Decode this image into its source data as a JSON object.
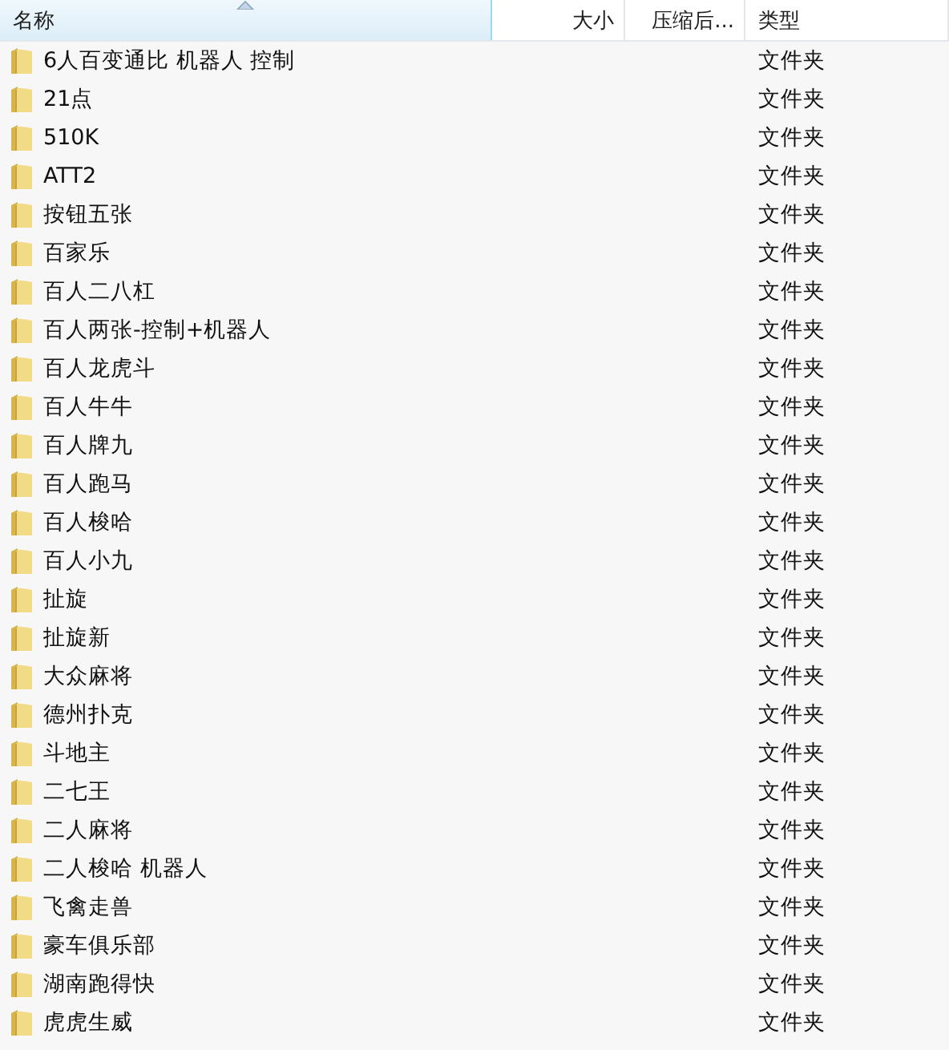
{
  "columns": [
    {
      "label": "名称",
      "sorted": true
    },
    {
      "label": "大小",
      "sorted": false
    },
    {
      "label": "压缩后...",
      "sorted": false
    },
    {
      "label": "类型",
      "sorted": false
    }
  ],
  "rows": [
    {
      "name": "6人百变通比 机器人 控制",
      "type": "文件夹"
    },
    {
      "name": "21点",
      "type": "文件夹"
    },
    {
      "name": "510K",
      "type": "文件夹"
    },
    {
      "name": "ATT2",
      "type": "文件夹"
    },
    {
      "name": "按钮五张",
      "type": "文件夹"
    },
    {
      "name": "百家乐",
      "type": "文件夹"
    },
    {
      "name": "百人二八杠",
      "type": "文件夹"
    },
    {
      "name": "百人两张-控制+机器人",
      "type": "文件夹"
    },
    {
      "name": "百人龙虎斗",
      "type": "文件夹"
    },
    {
      "name": "百人牛牛",
      "type": "文件夹"
    },
    {
      "name": "百人牌九",
      "type": "文件夹"
    },
    {
      "name": "百人跑马",
      "type": "文件夹"
    },
    {
      "name": "百人梭哈",
      "type": "文件夹"
    },
    {
      "name": "百人小九",
      "type": "文件夹"
    },
    {
      "name": "扯旋",
      "type": "文件夹"
    },
    {
      "name": "扯旋新",
      "type": "文件夹"
    },
    {
      "name": "大众麻将",
      "type": "文件夹"
    },
    {
      "name": "德州扑克",
      "type": "文件夹"
    },
    {
      "name": "斗地主",
      "type": "文件夹"
    },
    {
      "name": "二七王",
      "type": "文件夹"
    },
    {
      "name": "二人麻将",
      "type": "文件夹"
    },
    {
      "name": "二人梭哈 机器人",
      "type": "文件夹"
    },
    {
      "name": "飞禽走兽",
      "type": "文件夹"
    },
    {
      "name": "豪车俱乐部",
      "type": "文件夹"
    },
    {
      "name": "湖南跑得快",
      "type": "文件夹"
    },
    {
      "name": "虎虎生威",
      "type": "文件夹"
    }
  ]
}
